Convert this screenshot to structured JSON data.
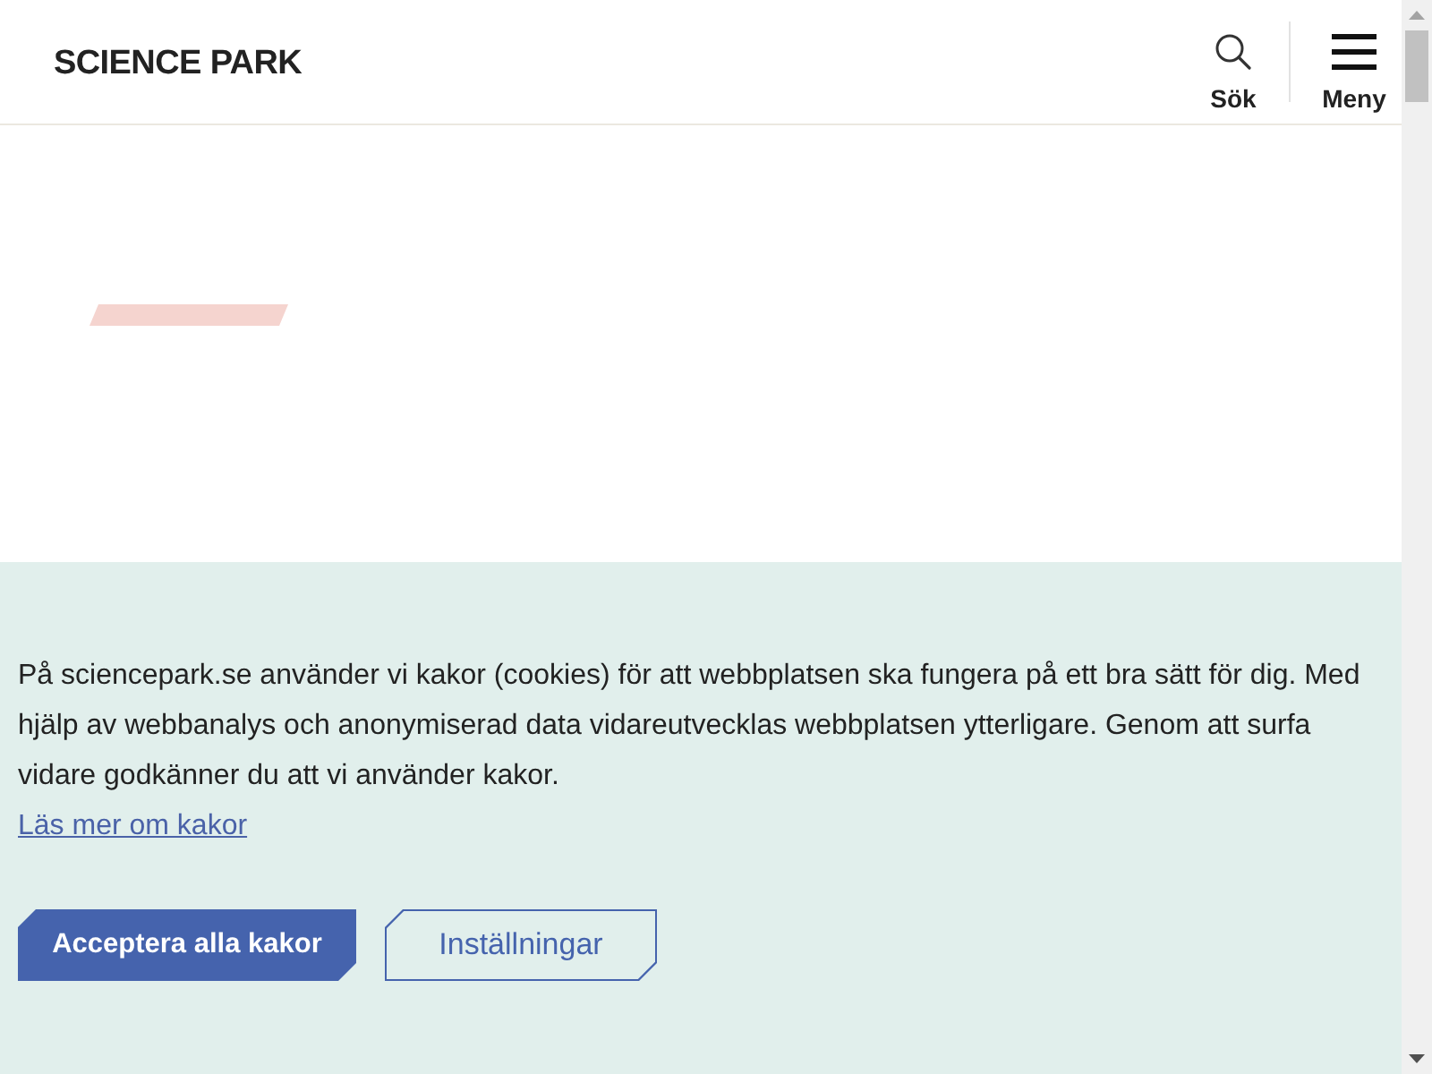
{
  "header": {
    "logo": "SCIENCE PARK",
    "actions": [
      {
        "kind": "search",
        "label": "Sök"
      },
      {
        "kind": "menu",
        "label": "Meny"
      }
    ]
  },
  "cookie_banner": {
    "text": "På sciencepark.se använder vi kakor (cookies) för att webbplatsen ska fungera på ett bra sätt för dig. Med hjälp av webbanalys och anonymiserad data vidareutvecklas webbplatsen ytterligare. Genom att surfa vidare godkänner du att vi använder kakor.",
    "link": "Läs mer om kakor",
    "buttons": [
      {
        "kind": "primary",
        "label": "Acceptera alla kakor"
      },
      {
        "kind": "secondary",
        "label": "Inställningar"
      }
    ]
  }
}
